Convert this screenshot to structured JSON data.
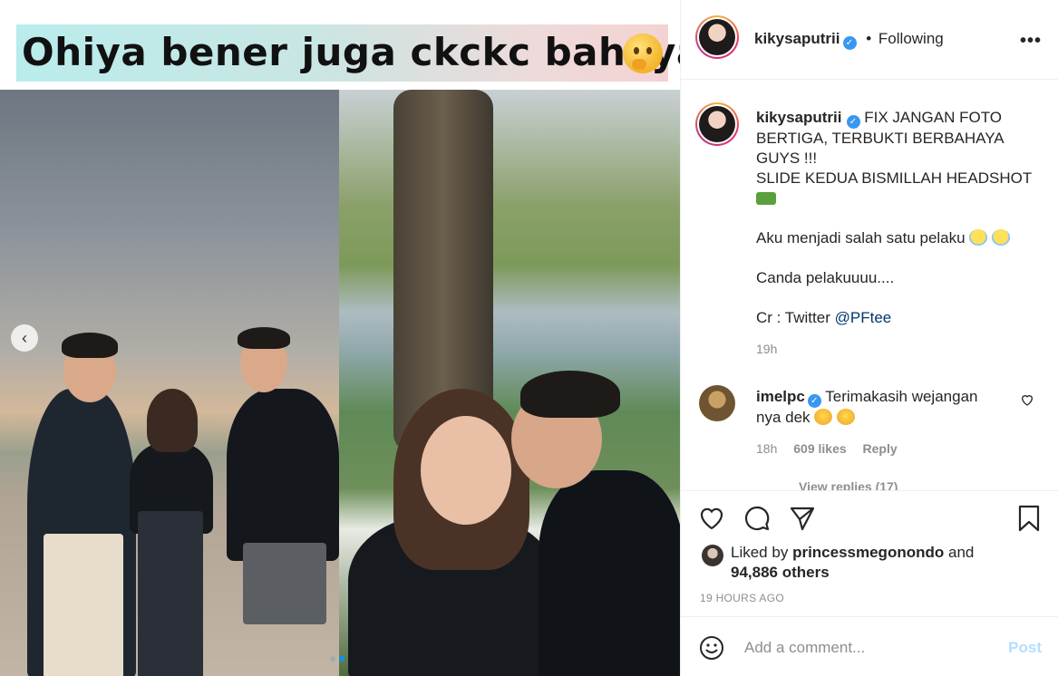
{
  "media": {
    "banner_text": "Ohiya bener juga ckckc bahaya",
    "banner_emoji": "thinking-face-emoji",
    "carousel": {
      "total_slides": 2,
      "active_index": 1
    }
  },
  "header": {
    "username": "kikysaputrii",
    "separator": "•",
    "follow_status": "Following",
    "more_label": "•••"
  },
  "caption": {
    "username": "kikysaputrii",
    "line1": "FIX JANGAN FOTO BERTIGA, TERBUKTI BERBAHAYA GUYS !!!",
    "line2": "SLIDE KEDUA BISMILLAH HEADSHOT",
    "line3": "Aku menjadi salah satu pelaku",
    "line4": "Canda pelakuuuu....",
    "line5_prefix": "Cr : Twitter",
    "mention": "@PFtee",
    "time": "19h"
  },
  "comment": {
    "username": "imelpc",
    "text": "Terimakasih wejangan nya dek",
    "time": "18h",
    "likes": "609 likes",
    "reply": "Reply",
    "view_replies": "View replies (17)"
  },
  "likes": {
    "prefix": "Liked by",
    "user": "princessmegonondo",
    "conjunction": "and",
    "others": "94,886 others"
  },
  "posted_time": "19 HOURS AGO",
  "add_comment": {
    "placeholder": "Add a comment...",
    "post_label": "Post"
  },
  "colors": {
    "verified": "#3897f0",
    "mention": "#00376b",
    "post_disabled": "#b2dffc",
    "active_dot": "#0095f6"
  }
}
